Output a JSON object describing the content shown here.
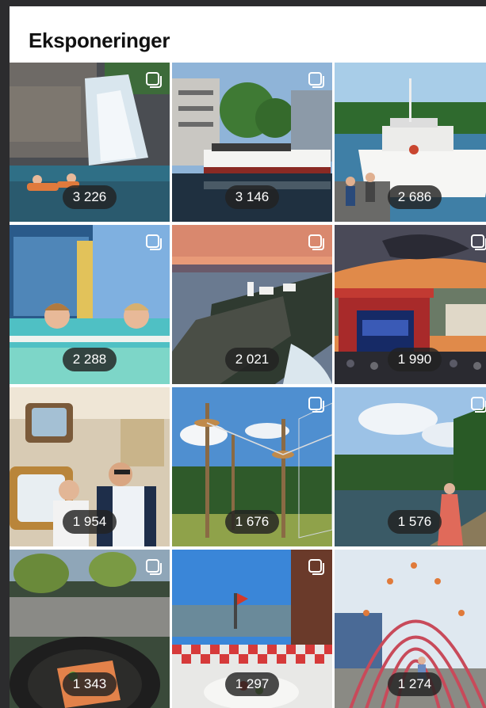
{
  "page": {
    "title": "Eksponeringer"
  },
  "posts": [
    {
      "count": "3 226",
      "scene": "waterfall-pool"
    },
    {
      "count": "3 146",
      "scene": "harbor-ferry"
    },
    {
      "count": "2 686",
      "scene": "sightseeing-boat"
    },
    {
      "count": "2 288",
      "scene": "kids-in-pool"
    },
    {
      "count": "2 021",
      "scene": "lighthouse-coast"
    },
    {
      "count": "1 990",
      "scene": "outdoor-concert"
    },
    {
      "count": "1 954",
      "scene": "ship-captains"
    },
    {
      "count": "1 676",
      "scene": "rope-course"
    },
    {
      "count": "1 576",
      "scene": "river-woman"
    },
    {
      "count": "1 343",
      "scene": "food-plate"
    },
    {
      "count": "1 297",
      "scene": "cafe-table"
    },
    {
      "count": "1 274",
      "scene": "flower-arches"
    }
  ],
  "colors": {
    "badge_bg": "#222222",
    "title": "#111111"
  }
}
